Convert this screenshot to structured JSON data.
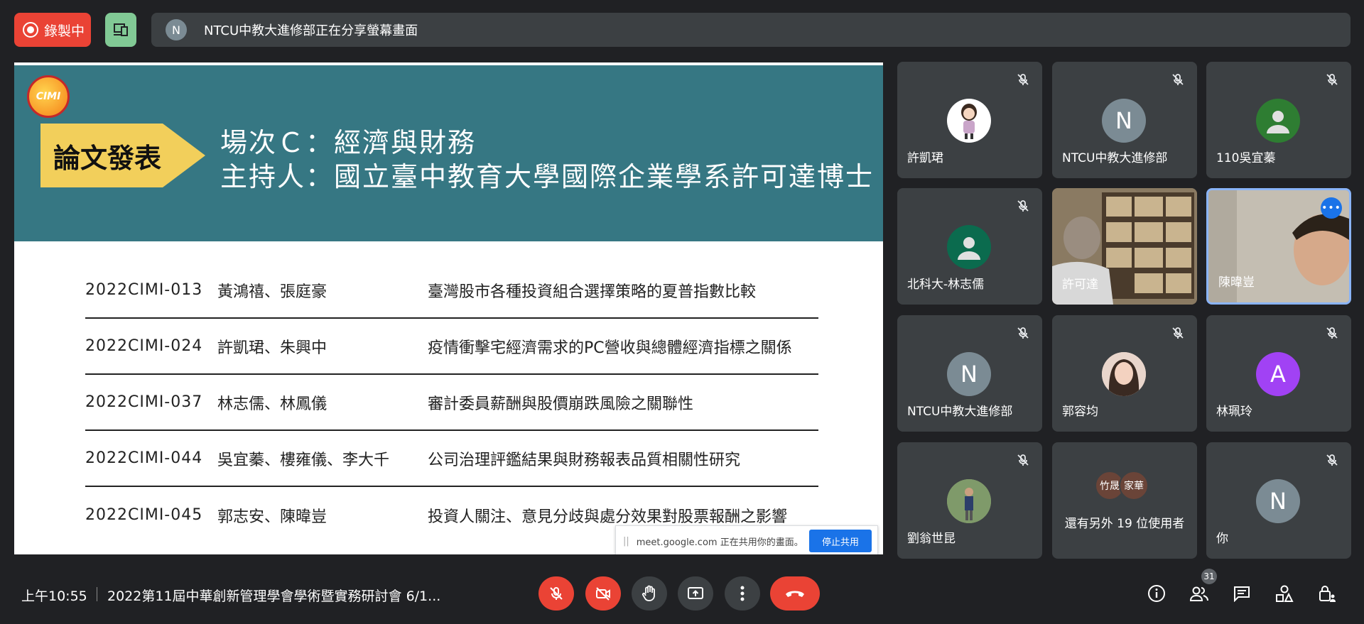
{
  "topbar": {
    "recording_label": "錄製中",
    "presenter_initial": "N",
    "share_banner": "NTCU中教大進修部正在分享螢幕畫面"
  },
  "slide": {
    "tag": "論文發表",
    "session": "場次Ｃ：經濟與財務",
    "host": "主持人：國立臺中教育大學國際企業學系許可達博士",
    "papers": [
      {
        "id": "2022CIMI-013",
        "authors": "黃鴻禧、張庭豪",
        "title": "臺灣股市各種投資組合選擇策略的夏普指數比較"
      },
      {
        "id": "2022CIMI-024",
        "authors": "許凱珺、朱興中",
        "title": "疫情衝擊宅經濟需求的PC營收與總體經濟指標之關係"
      },
      {
        "id": "2022CIMI-037",
        "authors": "林志儒、林鳳儀",
        "title": "審計委員薪酬與股價崩跌風險之關聯性"
      },
      {
        "id": "2022CIMI-044",
        "authors": "吳宜蓁、樓雍儀、李大千",
        "title": "公司治理評鑑結果與財務報表品質相關性研究"
      },
      {
        "id": "2022CIMI-045",
        "authors": "郭志安、陳暐豈",
        "title": "投資人關注、意見分歧與處分效果對股票報酬之影響"
      }
    ],
    "share_popup_text": "meet.google.com 正在共用你的畫面。",
    "stop_share_label": "停止共用"
  },
  "participants": [
    {
      "name": "許凱珺",
      "avatar": "",
      "color": "#ffffff"
    },
    {
      "name": "NTCU中教大進修部",
      "avatar": "N",
      "color": "#7b8b94"
    },
    {
      "name": "110吳宜蓁",
      "avatar": "",
      "color": "#2e7d32"
    },
    {
      "name": "北科大-林志儒",
      "avatar": "",
      "color": "#0b6b4e"
    },
    {
      "name": "許可達",
      "avatar": "",
      "color": ""
    },
    {
      "name": "陳暐豈",
      "avatar": "",
      "color": ""
    },
    {
      "name": "NTCU中教大進修部",
      "avatar": "N",
      "color": "#7b8b94"
    },
    {
      "name": "郭容均",
      "avatar": "",
      "color": "#d7b8a8"
    },
    {
      "name": "林珮玲",
      "avatar": "A",
      "color": "#a142f4"
    },
    {
      "name": "劉翁世昆",
      "avatar": "",
      "color": "#8a9a6a"
    },
    {
      "name": "你",
      "avatar": "N",
      "color": "#7b8b94"
    }
  ],
  "others": {
    "avatars": [
      "竹晟",
      "家華"
    ],
    "label": "還有另外 19 位使用者"
  },
  "bottombar": {
    "clock": "上午10:55",
    "meeting_title": "2022第11屆中華創新管理學會學術暨實務研討會 6/1...",
    "people_count": "31"
  }
}
